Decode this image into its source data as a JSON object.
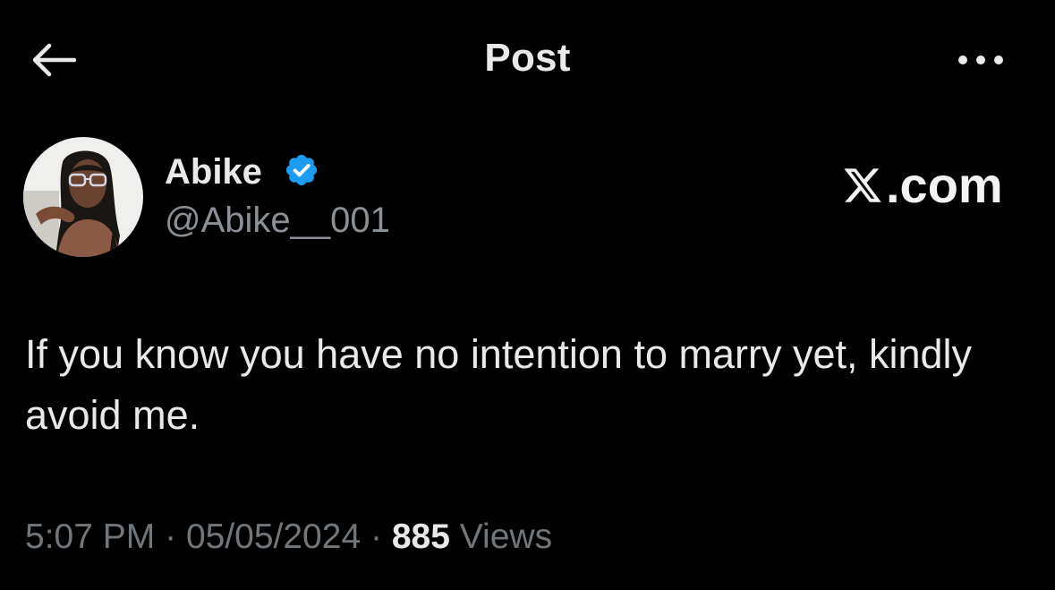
{
  "header": {
    "title": "Post",
    "back_icon": "arrow-left-icon",
    "more_icon": "more-horizontal-icon"
  },
  "author": {
    "display_name": "Abike",
    "handle": "@Abike__001",
    "verified": true,
    "verified_color": "#1d9bf0"
  },
  "watermark": {
    "text": ".com",
    "logo_icon": "x-logo-icon"
  },
  "post": {
    "text": "If you know you have no intention to marry yet, kindly avoid me."
  },
  "meta": {
    "time": "5:07 PM",
    "separator": "·",
    "date": "05/05/2024",
    "views_count": "885",
    "views_label": "Views"
  },
  "colors": {
    "background": "#000000",
    "primary_text": "#e7e9ea",
    "secondary_text": "#71767b",
    "accent": "#1d9bf0"
  }
}
